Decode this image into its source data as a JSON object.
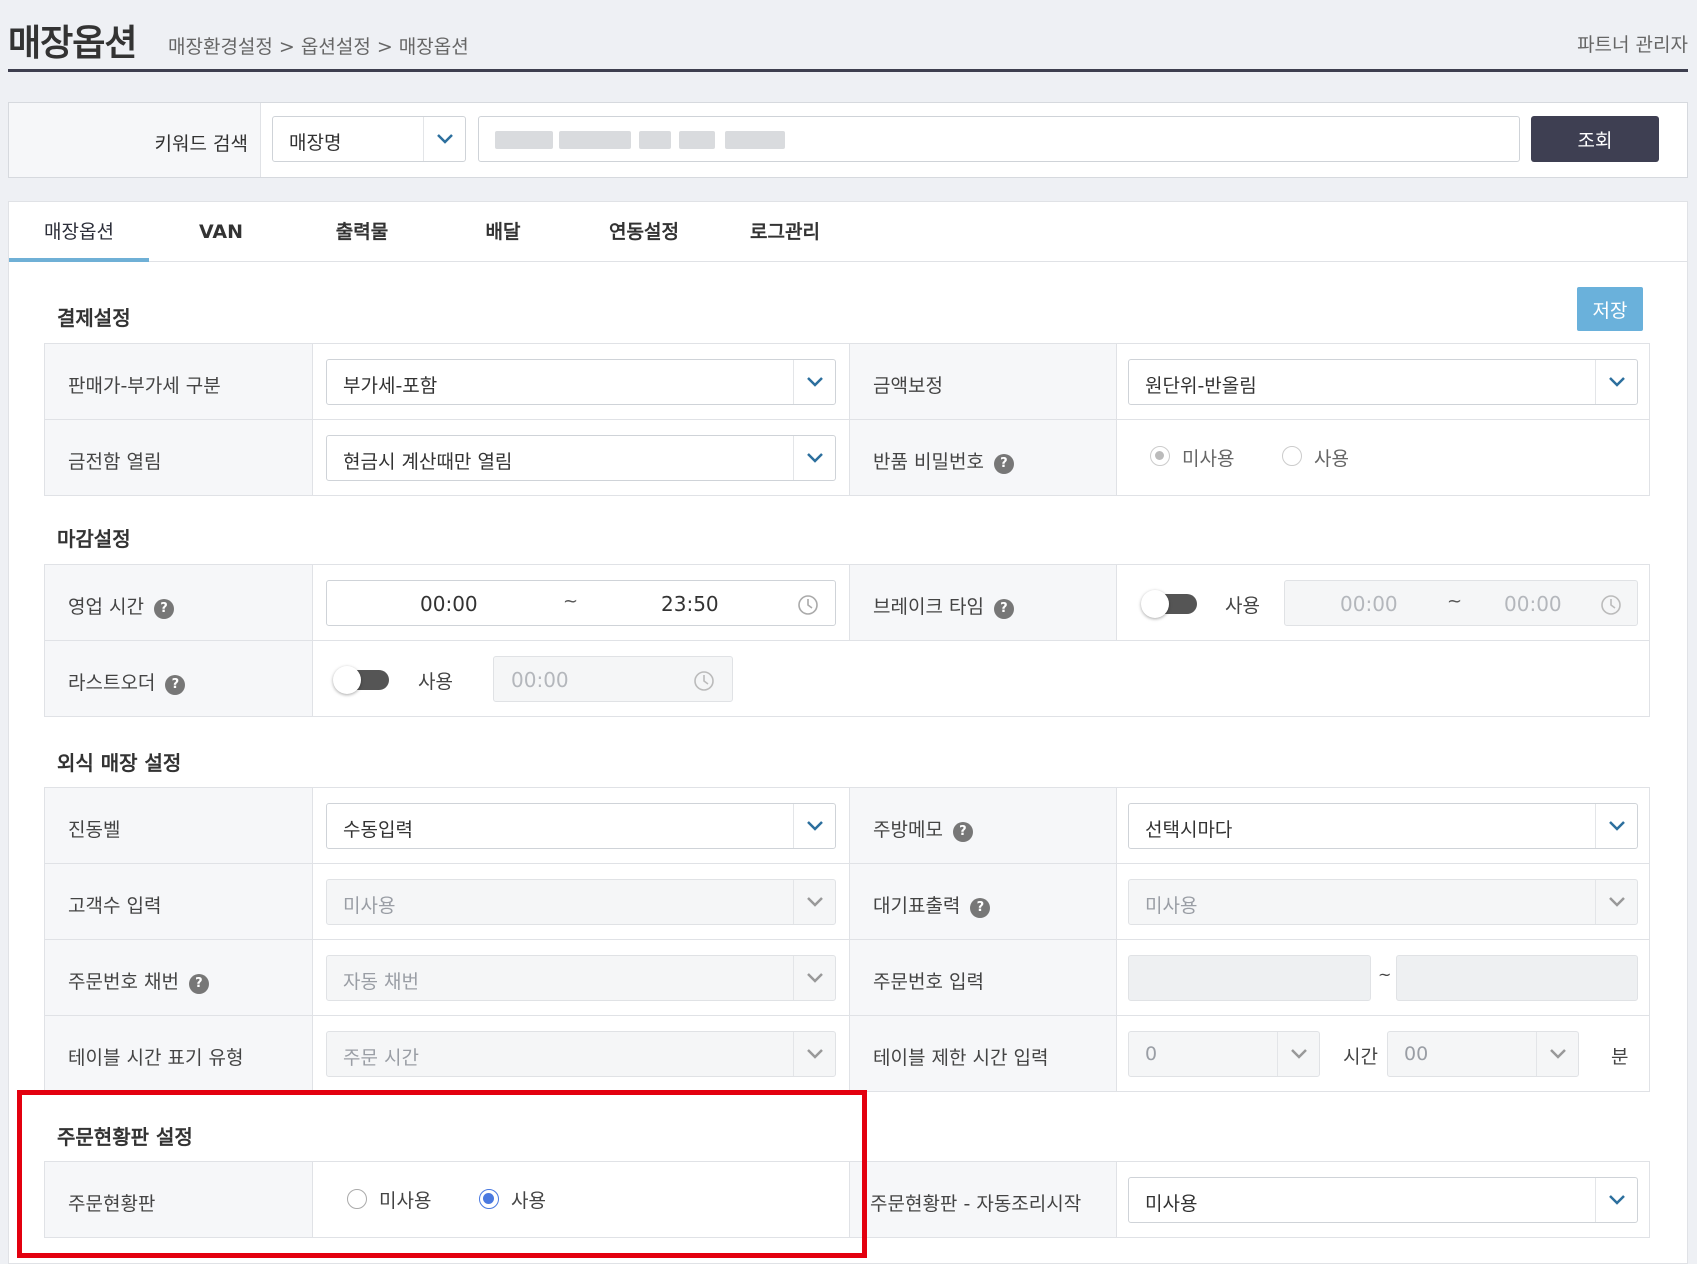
{
  "header": {
    "title": "매장옵션",
    "breadcrumb": "매장환경설정 > 옵션설정 > 매장옵션",
    "user_role": "파트너 관리자"
  },
  "search": {
    "label": "키워드 검색",
    "field_select": "매장명",
    "button": "조회"
  },
  "tabs": [
    "매장옵션",
    "VAN",
    "출력물",
    "배달",
    "연동설정",
    "로그관리"
  ],
  "save_button": "저장",
  "payment": {
    "title": "결제설정",
    "price_vat_label": "판매가-부가세 구분",
    "price_vat_value": "부가세-포함",
    "amount_correction_label": "금액보정",
    "amount_correction_value": "원단위-반올림",
    "cash_drawer_label": "금전함 열림",
    "cash_drawer_value": "현금시 계산때만 열림",
    "return_password_label": "반품 비밀번호",
    "return_password_options": [
      "미사용",
      "사용"
    ]
  },
  "closing": {
    "title": "마감설정",
    "business_hours_label": "영업 시간",
    "business_start": "00:00",
    "business_end": "23:50",
    "break_time_label": "브레이크 타임",
    "break_use": "사용",
    "break_start": "00:00",
    "break_end": "00:00",
    "last_order_label": "라스트오더",
    "last_order_use": "사용",
    "last_order_time": "00:00",
    "tilde": "~"
  },
  "dine_in": {
    "title": "외식 매장 설정",
    "pager_label": "진동벨",
    "pager_value": "수동입력",
    "kitchen_memo_label": "주방메모",
    "kitchen_memo_value": "선택시마다",
    "guest_count_label": "고객수 입력",
    "guest_count_value": "미사용",
    "waiting_ticket_label": "대기표출력",
    "waiting_ticket_value": "미사용",
    "order_no_label": "주문번호 채번",
    "order_no_value": "자동 채번",
    "order_no_input_label": "주문번호 입력",
    "order_no_range_sep": "~",
    "table_time_type_label": "테이블 시간 표기 유형",
    "table_time_type_value": "주문 시간",
    "table_limit_label": "테이블 제한 시간 입력",
    "table_limit_hours": "0",
    "hours_unit": "시간",
    "table_limit_minutes": "00",
    "minutes_unit": "분"
  },
  "order_board": {
    "title": "주문현황판 설정",
    "board_label": "주문현황판",
    "board_options": [
      "미사용",
      "사용"
    ],
    "auto_cook_label": "주문현황판 - 자동조리시작",
    "auto_cook_value": "미사용"
  },
  "colors": {
    "accent": "#6ab1db",
    "dark_button": "#3e3f52",
    "radio_selected": "#4a79e0",
    "highlight": "#e3000f"
  }
}
